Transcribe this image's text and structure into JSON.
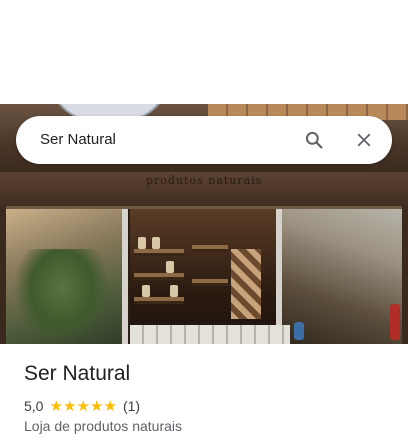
{
  "search": {
    "query": "Ser Natural",
    "search_icon": "search-icon",
    "close_icon": "close-icon"
  },
  "photo": {
    "storefront_sign": "produtos naturais"
  },
  "place": {
    "name": "Ser Natural",
    "rating": "5,0",
    "rating_value": 5.0,
    "stars_max": 5,
    "star_glyph": "★",
    "review_count": "(1)",
    "category": "Loja de produtos naturais"
  },
  "colors": {
    "star": "#fbbc04",
    "icon": "#5f6368",
    "title": "#202124",
    "secondary": "#5f6368"
  }
}
